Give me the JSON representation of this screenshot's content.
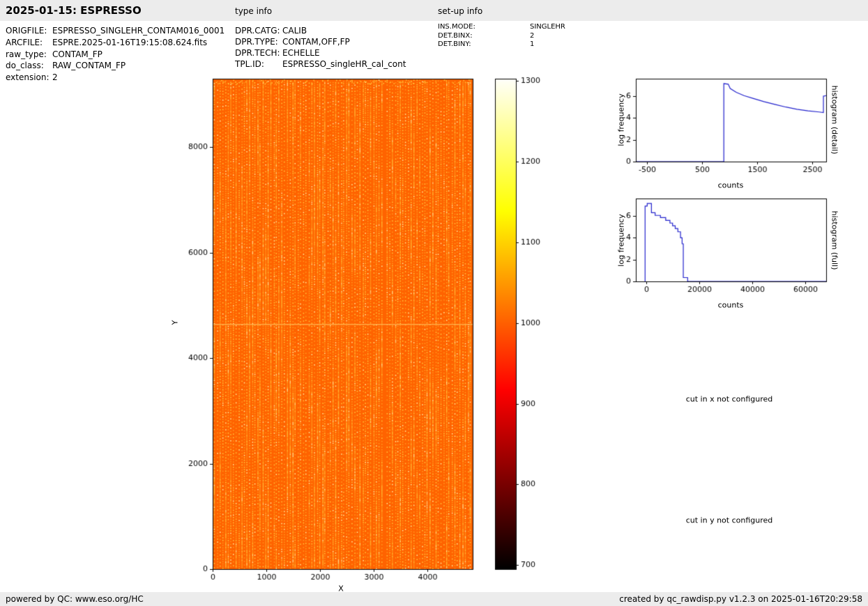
{
  "header": {
    "title": "2025-01-15: ESPRESSO",
    "type_info_label": "type info",
    "setup_info_label": "set-up info"
  },
  "file_info": {
    "rows": [
      {
        "label": "ORIGFILE:",
        "value": "ESPRESSO_SINGLEHR_CONTAM016_0001"
      },
      {
        "label": "ARCFILE:",
        "value": "ESPRE.2025-01-16T19:15:08.624.fits"
      },
      {
        "label": "raw_type:",
        "value": "CONTAM_FP"
      },
      {
        "label": "do_class:",
        "value": "RAW_CONTAM_FP"
      },
      {
        "label": "extension:",
        "value": "2"
      }
    ]
  },
  "type_info": {
    "rows": [
      {
        "label": "DPR.CATG:",
        "value": "CALIB"
      },
      {
        "label": "DPR.TYPE:",
        "value": "CONTAM,OFF,FP"
      },
      {
        "label": "DPR.TECH:",
        "value": "ECHELLE"
      },
      {
        "label": "TPL.ID:",
        "value": "ESPRESSO_singleHR_cal_cont"
      }
    ]
  },
  "setup_info": {
    "rows": [
      {
        "label": "INS.MODE:",
        "value": "SINGLEHR"
      },
      {
        "label": "DET.BINX:",
        "value": "2"
      },
      {
        "label": "DET.BINY:",
        "value": "1"
      }
    ]
  },
  "notes": {
    "cut_x": "cut in x not configured",
    "cut_y": "cut in y not configured"
  },
  "footer": {
    "left": "powered by QC: www.eso.org/HC",
    "right": "created by qc_rawdisp.py v1.2.3 on 2025-01-16T20:29:58"
  },
  "chart_data": [
    {
      "type": "heatmap",
      "name": "raw-frame",
      "xlabel": "X",
      "ylabel": "Y",
      "xlim": [
        0,
        4850
      ],
      "ylim": [
        0,
        9300
      ],
      "xticks": [
        0,
        1000,
        2000,
        3000,
        4000
      ],
      "yticks": [
        0,
        2000,
        4000,
        6000,
        8000
      ],
      "base_value": 1000,
      "bright_line_y": 4650,
      "colorbar": {
        "lim": [
          695,
          1303
        ],
        "ticks": [
          700,
          800,
          900,
          1000,
          1100,
          1200,
          1300
        ],
        "colormap": "hot",
        "gradient": [
          [
            0,
            "#000000"
          ],
          [
            0.365,
            "#ff0000"
          ],
          [
            0.73,
            "#ffff00"
          ],
          [
            1,
            "#fffffa"
          ]
        ]
      },
      "render": {
        "base_color": "#ff6300",
        "columns": 96,
        "dot_colors": [
          "#ff9a1e",
          "#ffc83c",
          "#fff2a0"
        ],
        "line_color": "#ffae4a"
      }
    },
    {
      "type": "line",
      "name": "histogram-detail",
      "right_label": "histogram (detail)",
      "xlabel": "counts",
      "ylabel": "log frequency",
      "xlim": [
        -700,
        2750
      ],
      "ylim": [
        0,
        7.6
      ],
      "xticks": [
        -500,
        500,
        1500,
        2500
      ],
      "yticks": [
        0,
        2,
        4,
        6
      ],
      "color": "#2222cc",
      "points": [
        [
          -700,
          0
        ],
        [
          895,
          0
        ],
        [
          895,
          7.15
        ],
        [
          975,
          7.1
        ],
        [
          1010,
          6.7
        ],
        [
          1120,
          6.35
        ],
        [
          1260,
          6.05
        ],
        [
          1420,
          5.8
        ],
        [
          1620,
          5.5
        ],
        [
          1820,
          5.25
        ],
        [
          2020,
          5.0
        ],
        [
          2220,
          4.8
        ],
        [
          2420,
          4.65
        ],
        [
          2620,
          4.55
        ],
        [
          2700,
          4.5
        ],
        [
          2700,
          6.0
        ],
        [
          2750,
          6.05
        ]
      ]
    },
    {
      "type": "line",
      "name": "histogram-full",
      "right_label": "histogram (full)",
      "xlabel": "counts",
      "ylabel": "log frequency",
      "xlim": [
        -4000,
        68000
      ],
      "ylim": [
        0,
        7.6
      ],
      "xticks": [
        0,
        20000,
        40000,
        60000
      ],
      "yticks": [
        0,
        2,
        4,
        6
      ],
      "color": "#2222cc",
      "points": [
        [
          -500,
          0
        ],
        [
          -500,
          6.9
        ],
        [
          300,
          6.9
        ],
        [
          300,
          7.15
        ],
        [
          1900,
          7.15
        ],
        [
          1900,
          6.3
        ],
        [
          3300,
          6.3
        ],
        [
          3300,
          6.05
        ],
        [
          5300,
          6.05
        ],
        [
          5300,
          5.85
        ],
        [
          7300,
          5.85
        ],
        [
          7300,
          5.6
        ],
        [
          8900,
          5.6
        ],
        [
          8900,
          5.35
        ],
        [
          9900,
          5.35
        ],
        [
          9900,
          5.1
        ],
        [
          10900,
          5.1
        ],
        [
          10900,
          4.85
        ],
        [
          11900,
          4.85
        ],
        [
          11900,
          4.55
        ],
        [
          12900,
          4.55
        ],
        [
          12900,
          4.0
        ],
        [
          13500,
          4.0
        ],
        [
          13500,
          3.45
        ],
        [
          13950,
          3.45
        ],
        [
          13950,
          0.35
        ],
        [
          15600,
          0.35
        ],
        [
          15600,
          0
        ],
        [
          68000,
          0
        ]
      ]
    }
  ]
}
